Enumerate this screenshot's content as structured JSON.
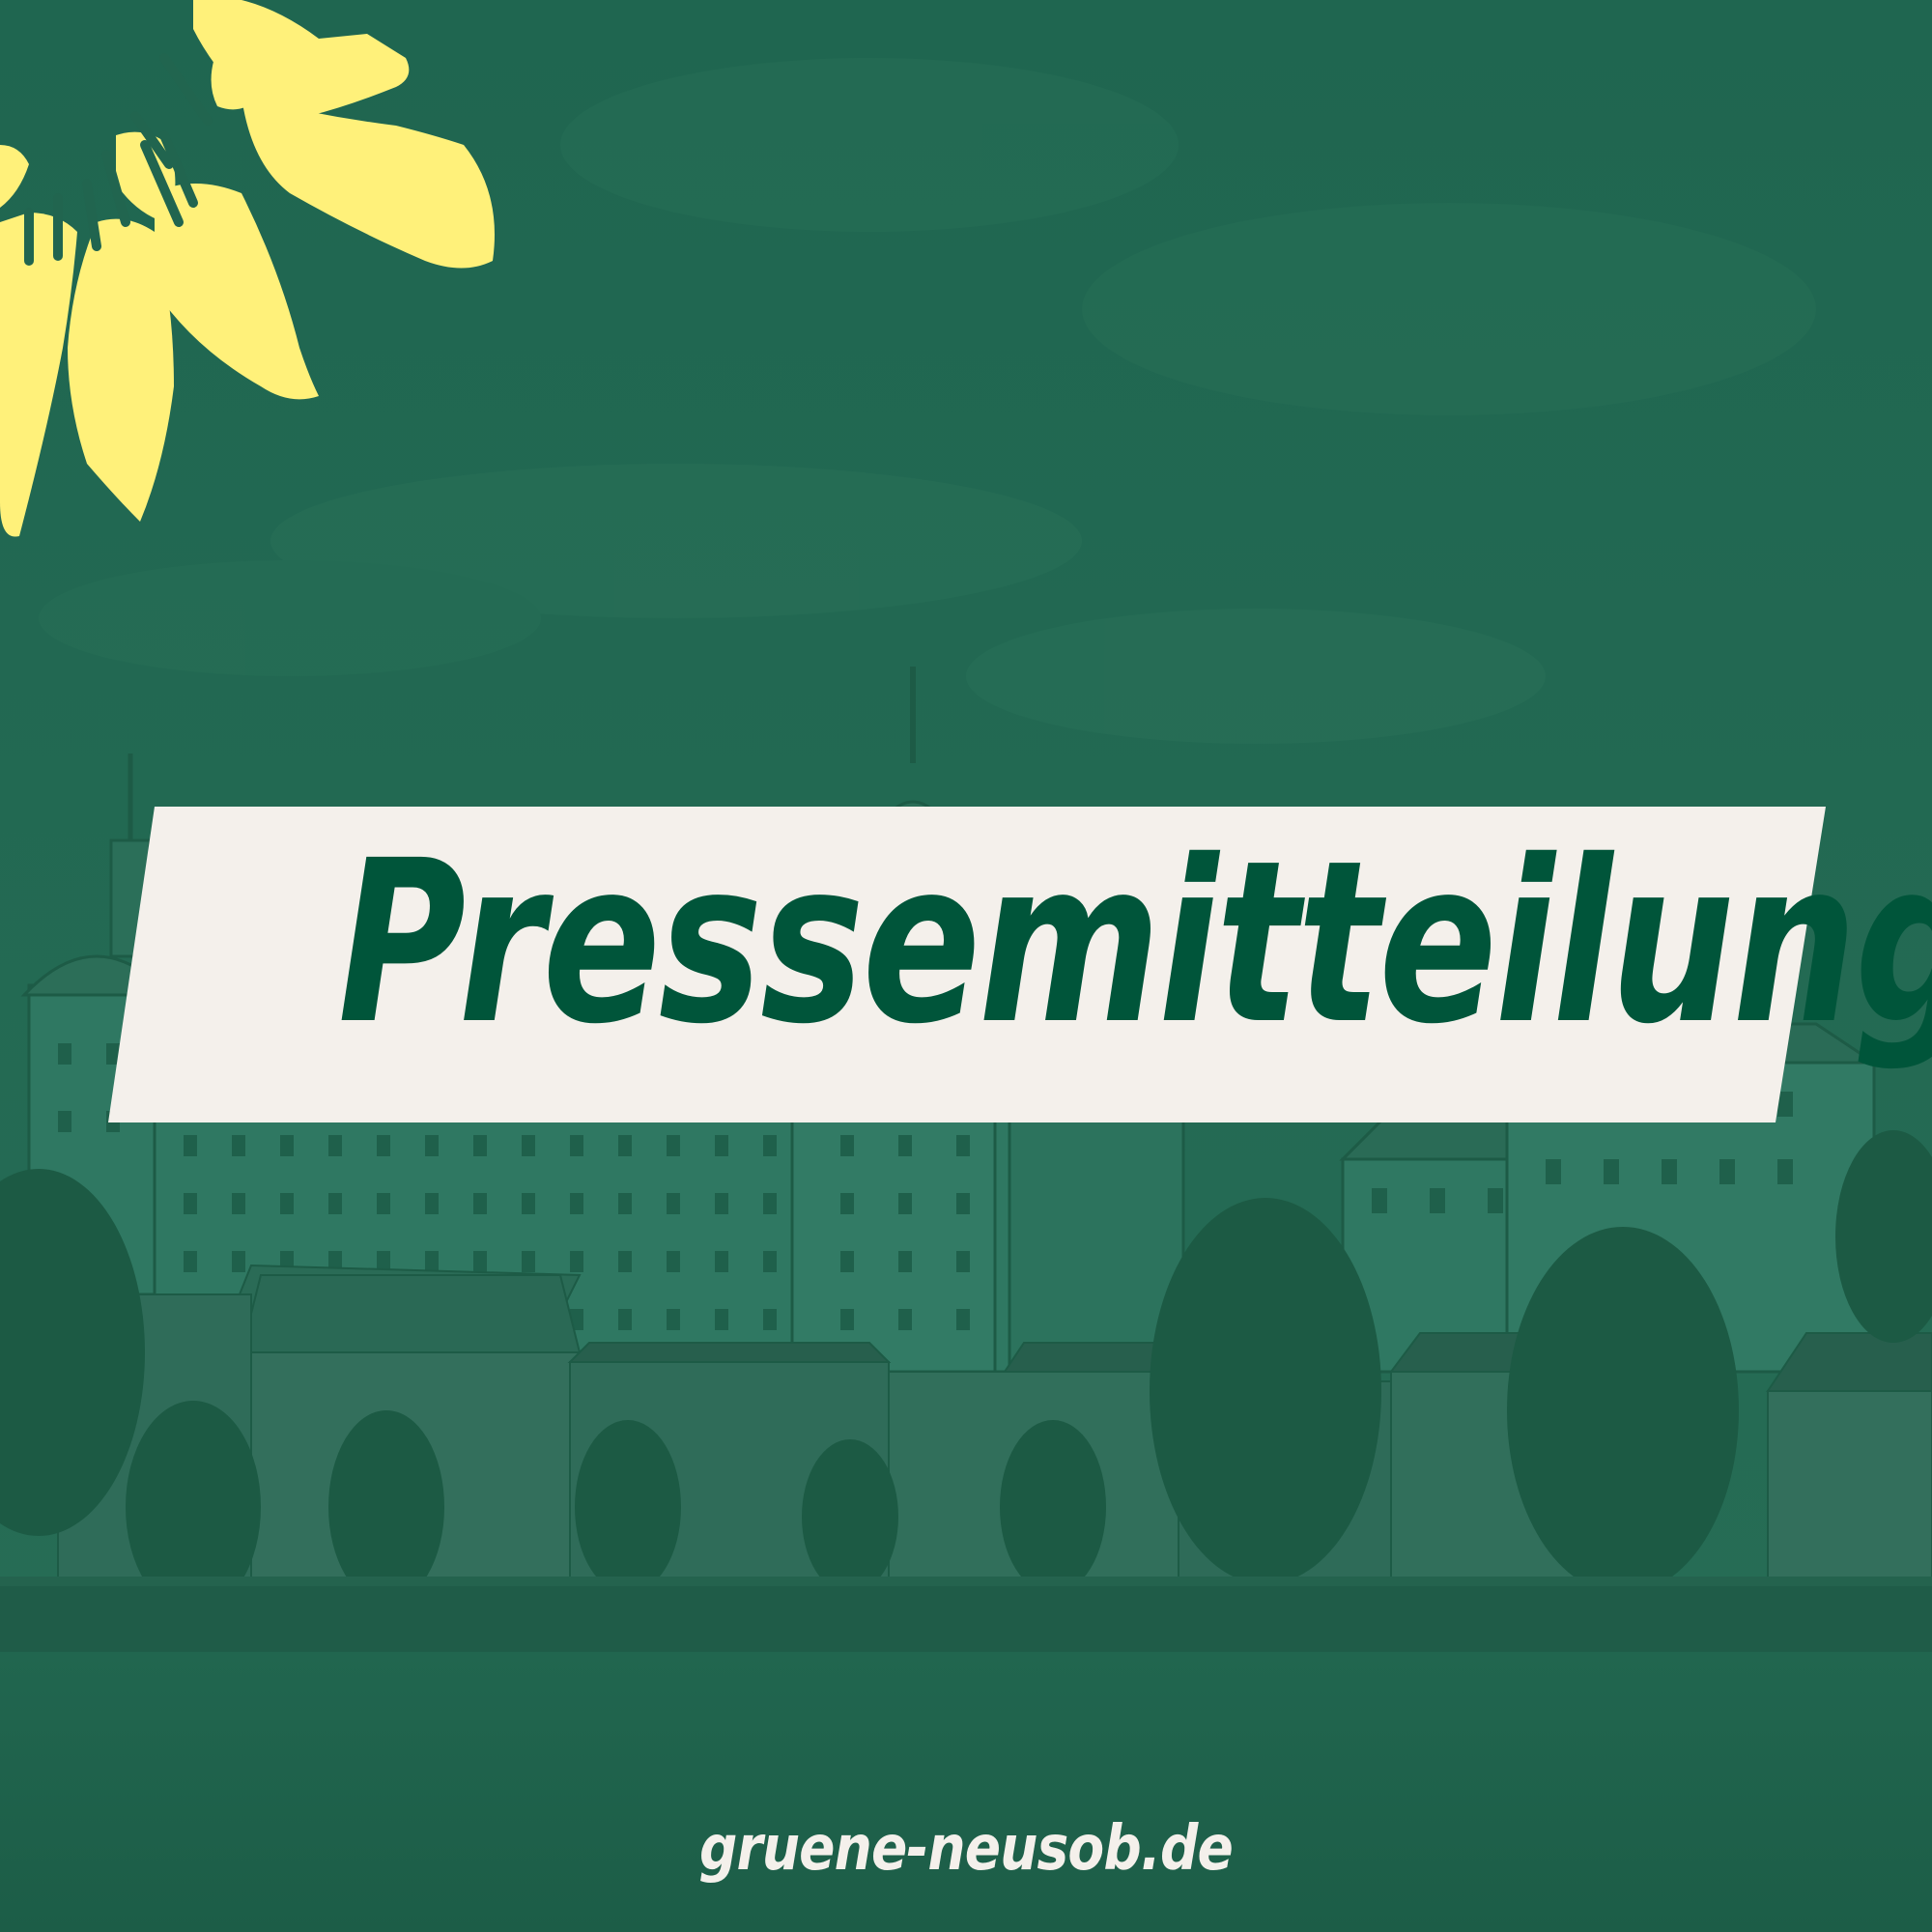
{
  "graphic": {
    "title": "Pressemitteilung",
    "url": "gruene-neusob.de"
  },
  "background": {
    "description_icon": "riverside-castle-photo",
    "tint_color": "#21654f"
  },
  "logo": {
    "icon": "sunflower-icon",
    "color": "#fff17a"
  },
  "colors": {
    "banner_bg": "#f4f0eb",
    "title_text": "#00553a",
    "footer_text": "#f4f0eb"
  }
}
